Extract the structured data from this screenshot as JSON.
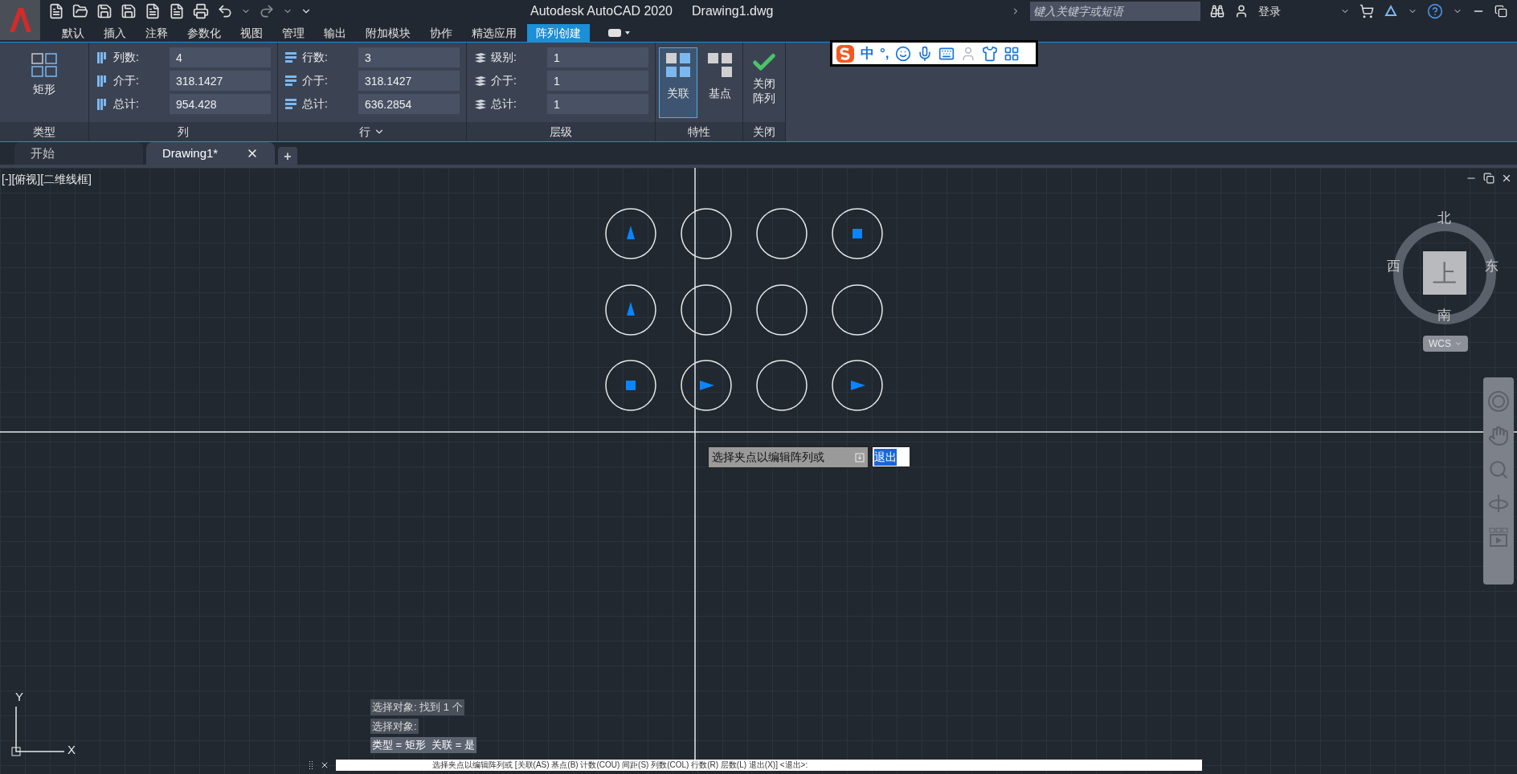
{
  "window": {
    "title": "Autodesk AutoCAD 2020",
    "document": "Drawing1.dwg"
  },
  "search": {
    "placeholder": "键入关键字或短语"
  },
  "account": {
    "label": "登录"
  },
  "ribbon_tabs": [
    {
      "label": "默认",
      "selected": false
    },
    {
      "label": "插入",
      "selected": false
    },
    {
      "label": "注释",
      "selected": false
    },
    {
      "label": "参数化",
      "selected": false
    },
    {
      "label": "视图",
      "selected": false
    },
    {
      "label": "管理",
      "selected": false
    },
    {
      "label": "输出",
      "selected": false
    },
    {
      "label": "附加模块",
      "selected": false
    },
    {
      "label": "协作",
      "selected": false
    },
    {
      "label": "精选应用",
      "selected": false
    },
    {
      "label": "阵列创建",
      "selected": true
    }
  ],
  "ime_toolbar": {
    "mode": "中",
    "punct": "°,"
  },
  "panels": [
    {
      "kind": "type",
      "title": "类型",
      "button": "矩形"
    },
    {
      "kind": "fields",
      "title": "列",
      "fields": [
        {
          "label": "列数:",
          "value": "4"
        },
        {
          "label": "介于:",
          "value": "318.1427"
        },
        {
          "label": "总计:",
          "value": "954.428"
        }
      ]
    },
    {
      "kind": "fields",
      "title": "行",
      "dropdown": true,
      "fields": [
        {
          "label": "行数:",
          "value": "3"
        },
        {
          "label": "介于:",
          "value": "318.1427"
        },
        {
          "label": "总计:",
          "value": "636.2854"
        }
      ]
    },
    {
      "kind": "fields",
      "title": "层级",
      "fields": [
        {
          "label": "级别:",
          "value": "1"
        },
        {
          "label": "介于:",
          "value": "1"
        },
        {
          "label": "总计:",
          "value": "1"
        }
      ]
    },
    {
      "kind": "props",
      "title": "特性",
      "buttons": [
        {
          "label": "关联",
          "selected": true
        },
        {
          "label": "基点",
          "selected": false
        }
      ]
    },
    {
      "kind": "close",
      "title": "关闭",
      "button": "关闭阵列"
    }
  ],
  "doc_tabs": [
    {
      "label": "开始",
      "selected": false,
      "closable": false
    },
    {
      "label": "Drawing1*",
      "selected": true,
      "closable": true
    }
  ],
  "new_tab": "+",
  "viewport_label": "[-][俯视][二维线框]",
  "array_grid": [
    [
      {
        "kind": "up"
      },
      {
        "kind": "none"
      },
      {
        "kind": "none"
      },
      {
        "kind": "square"
      }
    ],
    [
      {
        "kind": "up"
      },
      {
        "kind": "none"
      },
      {
        "kind": "none"
      },
      {
        "kind": "none"
      }
    ],
    [
      {
        "kind": "square"
      },
      {
        "kind": "right"
      },
      {
        "kind": "none"
      },
      {
        "kind": "right"
      }
    ]
  ],
  "viewcube": {
    "north": "北",
    "south": "南",
    "west": "西",
    "east": "东",
    "face": "上",
    "ucs": "WCS"
  },
  "tooltip": {
    "prompt": "选择夹点以编辑阵列或",
    "value": "退出"
  },
  "ucs_icon": {
    "y": "Y",
    "x": "X"
  },
  "command_history": [
    "选择对象: 找到 1 个",
    "选择对象:",
    "类型 = 矩形  关联 = 是"
  ],
  "command_line": "选择夹点以编辑阵列或 [关联(AS) 基点(B) 计数(COU) 间距(S) 列数(COL) 行数(R) 层数(L) 退出(X)] <退出>:"
}
